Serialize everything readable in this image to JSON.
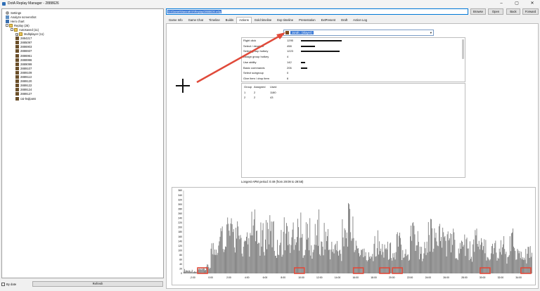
{
  "window": {
    "title": "DotA Replay Manager - 2888626",
    "controls": [
      "–",
      "▢",
      "✕"
    ]
  },
  "tree": {
    "items": [
      {
        "label": "Settings",
        "icon": "gear-icon",
        "level": 0
      },
      {
        "label": "Analyze screenshot",
        "icon": "screenshot-icon",
        "level": 0
      },
      {
        "label": "Hero chart",
        "icon": "hero-icon",
        "level": 0
      },
      {
        "label": "Replay (26)",
        "icon": "folder-icon",
        "level": 0,
        "expander": "-"
      },
      {
        "label": "Autosaved (11)",
        "icon": "folder-icon",
        "level": 1,
        "expander": "-"
      },
      {
        "label": "Multiplayer (11)",
        "icon": "folder-icon",
        "level": 2,
        "expander": "+"
      },
      {
        "label": "2884217",
        "icon": "replay-icon",
        "level": 2
      },
      {
        "label": "2885097",
        "icon": "replay-icon",
        "level": 2
      },
      {
        "label": "2886903",
        "icon": "replay-icon",
        "level": 2
      },
      {
        "label": "2886937",
        "icon": "replay-icon",
        "level": 2
      },
      {
        "label": "2886961",
        "icon": "replay-icon",
        "level": 2
      },
      {
        "label": "2888996",
        "icon": "replay-icon",
        "level": 2
      },
      {
        "label": "2889099",
        "icon": "replay-icon",
        "level": 2
      },
      {
        "label": "2889107",
        "icon": "replay-icon",
        "level": 2
      },
      {
        "label": "2889109",
        "icon": "replay-icon",
        "level": 2
      },
      {
        "label": "2889113",
        "icon": "replay-icon",
        "level": 2
      },
      {
        "label": "2889120",
        "icon": "replay-icon",
        "level": 2
      },
      {
        "label": "2889122",
        "icon": "replay-icon",
        "level": 2
      },
      {
        "label": "2889124",
        "icon": "replay-icon",
        "level": 2
      },
      {
        "label": "2889127",
        "icon": "replay-icon",
        "level": 2
      },
      {
        "label": "cai-leqlpass",
        "icon": "replay-icon",
        "level": 2
      }
    ],
    "by_date_label": "By date",
    "refresh_label": "Refresh"
  },
  "path": {
    "value": "D:\\Game\\Warcraft III\\Replay\\2888626.w3g"
  },
  "buttons": {
    "browse": "Browse",
    "open": "Open",
    "back": "Back",
    "forward": "Forward"
  },
  "tabs": [
    "Game Info",
    "Game Chat",
    "Timeline",
    "Builds",
    "Actions",
    "Gold timeline",
    "Exp timeline",
    "Presentation",
    "ExtPresent",
    "Draft",
    "Action Log"
  ],
  "active_tab": "Actions",
  "player_select": {
    "value": "Jorah.. (Slayer)"
  },
  "stats": [
    {
      "name": "Right click",
      "value": 1295,
      "bar": 1.0
    },
    {
      "name": "Select / deselect",
      "value": 458,
      "bar": 0.35
    },
    {
      "name": "Select group hotkey",
      "value": 1223,
      "bar": 0.94
    },
    {
      "name": "Assign group hotkey",
      "value": 4,
      "bar": 0.0
    },
    {
      "name": "Use ability",
      "value": 142,
      "bar": 0.11
    },
    {
      "name": "Basic commands",
      "value": 206,
      "bar": 0.16
    },
    {
      "name": "Select subgroup",
      "value": 0,
      "bar": 0.0
    },
    {
      "name": "Give item / drop item",
      "value": 6,
      "bar": 0.0
    }
  ],
  "group_table": {
    "headers": [
      "Group",
      "Assigned",
      "Used"
    ],
    "rows": [
      [
        "1",
        "2",
        "1180"
      ],
      [
        "2",
        "2",
        "43"
      ]
    ]
  },
  "longest_apm": "Longest APM period: 0:49 (from 29:09 to 29:58)",
  "chart_data": {
    "type": "bar",
    "title": "",
    "xlabel": "",
    "ylabel": "",
    "ylim": [
      0,
      360
    ],
    "y_ticks": [
      0,
      20,
      40,
      60,
      80,
      100,
      120,
      140,
      160,
      180,
      200,
      220,
      240,
      260,
      280,
      300,
      320,
      340,
      360
    ],
    "x_ticks": [
      "-2:00",
      "0:00",
      "2:00",
      "4:00",
      "6:00",
      "8:00",
      "10:00",
      "12:00",
      "14:00",
      "16:00",
      "18:00",
      "20:00",
      "22:00",
      "24:00",
      "26:00",
      "28:00",
      "30:00",
      "32:00",
      "34:00"
    ],
    "x_tick_minutes": [
      -2,
      0,
      2,
      4,
      6,
      8,
      10,
      12,
      14,
      16,
      18,
      20,
      22,
      24,
      26,
      28,
      30,
      32,
      34
    ],
    "x_range_minutes": [
      -3,
      35.5
    ],
    "bar_color": "#7a7a7a",
    "highlight_color": "#e04a3a",
    "highlight_minutes": [
      -0.9,
      9.8,
      16.3,
      19.2,
      20.6,
      30.3,
      34.8
    ],
    "values_per_minute": [
      20,
      18,
      10,
      24,
      25,
      40,
      152,
      189,
      230,
      288,
      244,
      240,
      217,
      167,
      185,
      288,
      190,
      222,
      268,
      256,
      154,
      201,
      262,
      191,
      281,
      269,
      193,
      244,
      141,
      283,
      158,
      237,
      154,
      166,
      127,
      303,
      308,
      252,
      144,
      150,
      100,
      128,
      203,
      150,
      177,
      142,
      113,
      193,
      159,
      117,
      289,
      204,
      127,
      146,
      241,
      199,
      244,
      217,
      200,
      211,
      111,
      295,
      203,
      142,
      233,
      168,
      156,
      127,
      164,
      134,
      168,
      117,
      198,
      144,
      103,
      109,
      120
    ]
  },
  "colors": {
    "accent": "#0078d7",
    "selection": "#3d7bd6",
    "arrow": "#e04a3a"
  }
}
